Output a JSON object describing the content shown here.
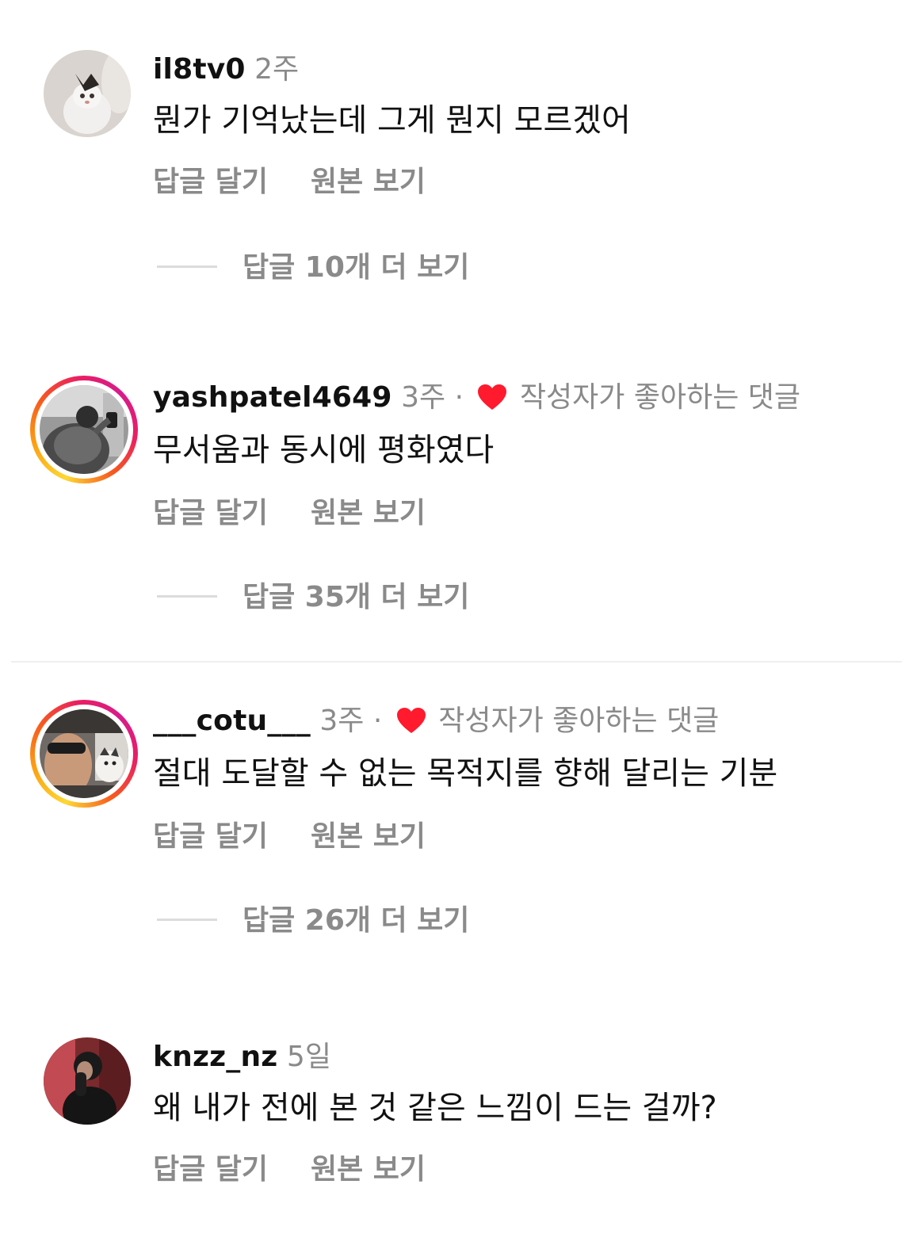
{
  "comments": [
    {
      "username": "il8tv0",
      "time": "2주",
      "text": "뭔가 기억났는데 그게 뭔지 모르겠어",
      "reply_label": "답글 달기",
      "original_label": "원본 보기",
      "more_replies": "답글 10개 더 보기",
      "liked_by_author": false
    },
    {
      "username": "yashpatel4649",
      "time": "3주",
      "separator": "·",
      "liked_text": "작성자가 좋아하는 댓글",
      "text": "무서움과 동시에 평화였다",
      "reply_label": "답글 달기",
      "original_label": "원본 보기",
      "more_replies": "답글 35개 더 보기",
      "liked_by_author": true
    },
    {
      "username": "___cotu___",
      "time": "3주",
      "separator": "·",
      "liked_text": "작성자가 좋아하는 댓글",
      "text": "절대 도달할 수 없는 목적지를 향해 달리는 기분",
      "reply_label": "답글 달기",
      "original_label": "원본 보기",
      "more_replies": "답글 26개 더 보기",
      "liked_by_author": true
    },
    {
      "username": "knzz_nz",
      "time": "5일",
      "text": "왜 내가 전에 본 것 같은 느낌이 드는 걸까?",
      "reply_label": "답글 달기",
      "original_label": "원본 보기",
      "liked_by_author": false
    }
  ],
  "colors": {
    "heart": "#ff1a2e",
    "muted_text": "#8a8a8a",
    "story_ring_start": "#fdd835",
    "story_ring_end": "#d81b8c"
  },
  "icons": {
    "heart": "heart-icon"
  }
}
